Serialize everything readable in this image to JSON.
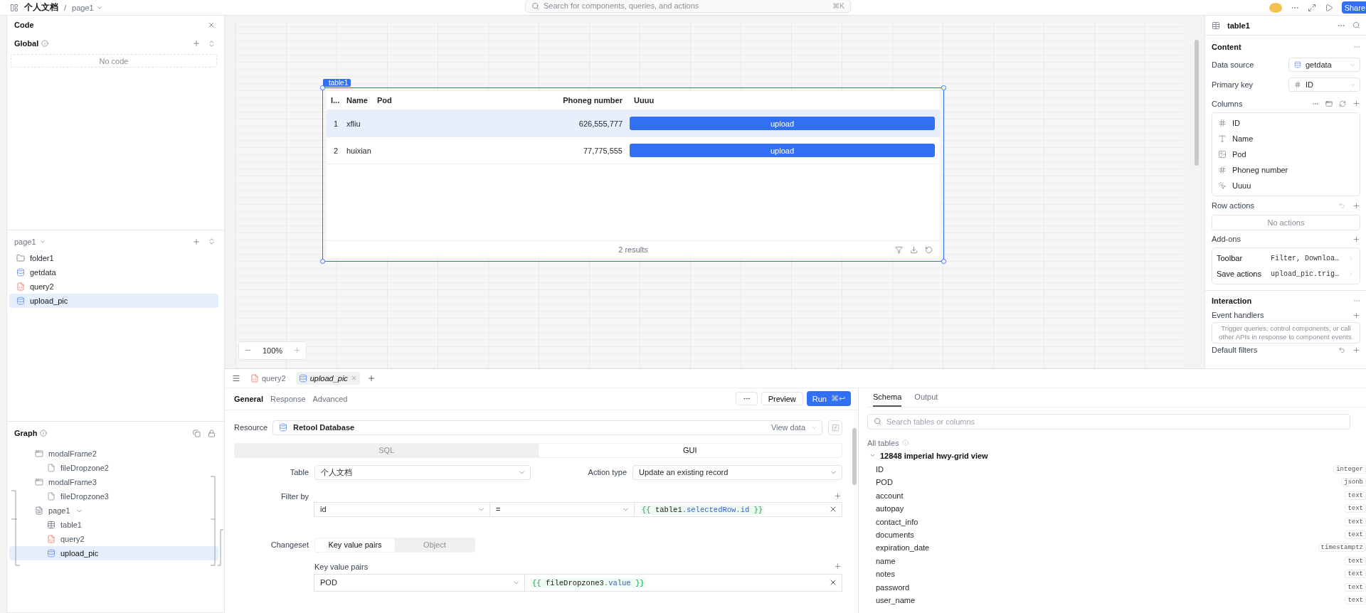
{
  "top_bar": {
    "breadcrumb": [
      "个人文档",
      "page1"
    ],
    "breadcrumb_separator": "/",
    "search": {
      "placeholder": "Search for components, queries, and actions",
      "shortcut": "⌘K"
    },
    "share_button": "Share"
  },
  "code_panel": {
    "title": "Code",
    "global_title": "Global",
    "empty_text": "No code"
  },
  "page_panel": {
    "title": "page1",
    "items": [
      {
        "label": "folder1",
        "kind": "folder",
        "selected": false
      },
      {
        "label": "getdata",
        "kind": "database",
        "selected": false
      },
      {
        "label": "query2",
        "kind": "js",
        "selected": false
      },
      {
        "label": "upload_pic",
        "kind": "database",
        "selected": true
      }
    ]
  },
  "graph_panel": {
    "title": "Graph",
    "nodes": [
      {
        "label": "modalFrame2",
        "kind": "frame",
        "selected": false,
        "children": [
          {
            "label": "fileDropzone2",
            "kind": "dropzone",
            "selected": false
          }
        ]
      },
      {
        "label": "modalFrame3",
        "kind": "frame",
        "selected": false,
        "children": [
          {
            "label": "fileDropzone3",
            "kind": "dropzone",
            "selected": false
          }
        ]
      },
      {
        "label": "page1",
        "kind": "page",
        "selected": false,
        "expanded": true,
        "children": [
          {
            "label": "table1",
            "kind": "table",
            "selected": false
          },
          {
            "label": "query2",
            "kind": "js",
            "selected": false
          },
          {
            "label": "upload_pic",
            "kind": "database",
            "selected": true
          }
        ]
      }
    ]
  },
  "canvas": {
    "component_label": "table1",
    "zoom": "100%",
    "table": {
      "columns": [
        "I...",
        "Name",
        "Pod",
        "Phoneg number",
        "Uuuu"
      ],
      "rows": [
        {
          "index": "1",
          "name": "xfliu",
          "phone": "626,555,777",
          "action": "upload",
          "selected": true
        },
        {
          "index": "2",
          "name": "huixian",
          "phone": "77,775,555",
          "action": "upload",
          "selected": false
        }
      ],
      "footer": "2 results"
    }
  },
  "inspector": {
    "title": "table1",
    "content_title": "Content",
    "data_source": {
      "label": "Data source",
      "value": "getdata"
    },
    "primary_key": {
      "label": "Primary key",
      "value": "ID"
    },
    "columns_label": "Columns",
    "columns": [
      {
        "label": "ID",
        "kind": "number"
      },
      {
        "label": "Name",
        "kind": "text"
      },
      {
        "label": "Pod",
        "kind": "image"
      },
      {
        "label": "Phoneg number",
        "kind": "number"
      },
      {
        "label": "Uuuu",
        "kind": "button"
      }
    ],
    "row_actions": {
      "label": "Row actions",
      "empty": "No actions"
    },
    "addons_label": "Add-ons",
    "addons": [
      {
        "label": "Toolbar",
        "value": "Filter, Downloa…"
      },
      {
        "label": "Save actions",
        "value": "upload_pic.trig…"
      }
    ],
    "interaction_title": "Interaction",
    "event_handlers": {
      "label": "Event handlers",
      "hint": "Trigger queries, control components, or call other APIs in response to component events."
    },
    "default_filters": "Default filters"
  },
  "editor": {
    "tabs": [
      {
        "label": "query2",
        "kind": "js",
        "selected": false
      },
      {
        "label": "upload_pic",
        "kind": "database",
        "selected": true
      }
    ],
    "sections": [
      {
        "label": "General",
        "selected": true
      },
      {
        "label": "Response",
        "selected": false
      },
      {
        "label": "Advanced",
        "selected": false
      }
    ],
    "preview_button": "Preview",
    "run_button": "Run",
    "run_shortcut": "⌘↩",
    "resource": {
      "label": "Resource",
      "value": "Retool Database",
      "link": "View data"
    },
    "modes": [
      {
        "label": "SQL",
        "selected": false
      },
      {
        "label": "GUI",
        "selected": true
      }
    ],
    "table": {
      "label": "Table",
      "value": "个人文档"
    },
    "action_type": {
      "label": "Action type",
      "value": "Update an existing record"
    },
    "filter": {
      "label": "Filter by",
      "column": "id",
      "operator": "=",
      "value": "{{ table1.selectedRow.id }}"
    },
    "changeset": {
      "label": "Changeset",
      "modes": [
        {
          "label": "Key value pairs",
          "selected": true
        },
        {
          "label": "Object",
          "selected": false
        }
      ],
      "pairs_label": "Key value pairs",
      "pairs": [
        {
          "key": "POD",
          "value": "{{ fileDropzone3.value }}"
        }
      ]
    }
  },
  "schema": {
    "tabs": [
      {
        "label": "Schema",
        "selected": true
      },
      {
        "label": "Output",
        "selected": false
      }
    ],
    "search_placeholder": "Search tables or columns",
    "all_tables": "All tables",
    "table": {
      "name": "12848 imperial hwy-grid view",
      "expanded": true,
      "columns": [
        {
          "name": "ID",
          "type": "integer"
        },
        {
          "name": "POD",
          "type": "jsonb"
        },
        {
          "name": "account",
          "type": "text"
        },
        {
          "name": "autopay",
          "type": "text"
        },
        {
          "name": "contact_info",
          "type": "text"
        },
        {
          "name": "documents",
          "type": "text"
        },
        {
          "name": "expiration_date",
          "type": "timestamptz"
        },
        {
          "name": "name",
          "type": "text"
        },
        {
          "name": "notes",
          "type": "text"
        },
        {
          "name": "password",
          "type": "text"
        },
        {
          "name": "user_name",
          "type": "text"
        }
      ]
    }
  }
}
